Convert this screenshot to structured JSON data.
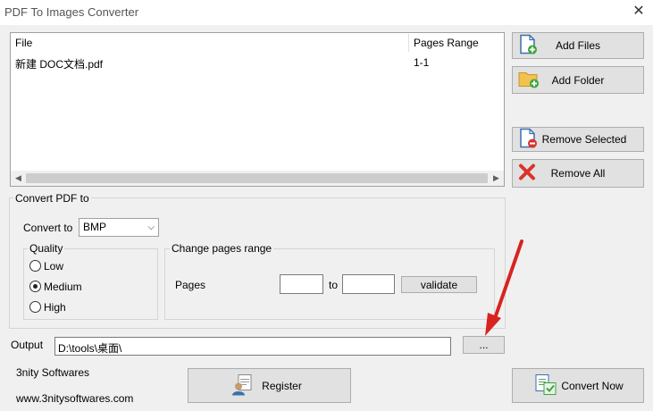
{
  "window": {
    "title": "PDF To Images Converter",
    "close": "✕"
  },
  "file_list": {
    "columns": [
      "File",
      "Pages Range"
    ],
    "rows": [
      {
        "file": "新建 DOC文档.pdf",
        "range": "1-1"
      }
    ]
  },
  "buttons": {
    "add_files": "Add Files",
    "add_folder": "Add Folder",
    "remove_selected": "Remove Selected",
    "remove_all": "Remove All",
    "validate": "validate",
    "browse": "...",
    "register": "Register",
    "convert_now": "Convert Now"
  },
  "convert": {
    "group_label": "Convert PDF to",
    "convert_to_label": "Convert to",
    "format": "BMP",
    "quality_label": "Quality",
    "quality_options": [
      "Low",
      "Medium",
      "High"
    ],
    "quality_selected": "Medium",
    "pages_group_label": "Change pages range",
    "pages_label": "Pages",
    "to_label": "to",
    "from_value": "",
    "to_value": ""
  },
  "output": {
    "label": "Output",
    "path": "D:\\tools\\桌面\\"
  },
  "footer": {
    "company": "3nity Softwares",
    "website": "www.3nitysoftwares.com"
  },
  "colors": {
    "accent_arrow": "#d8231f",
    "button_bg": "#e1e1e1"
  }
}
